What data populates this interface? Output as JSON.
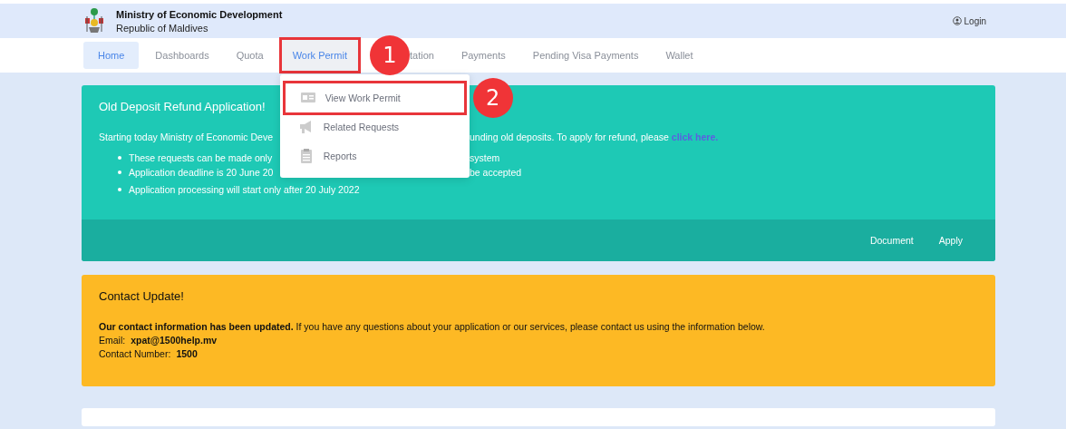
{
  "header": {
    "title": "Ministry of Economic Development",
    "subtitle": "Republic of Maldives",
    "login": "Login"
  },
  "nav": [
    {
      "label": "Home",
      "selected": true,
      "expanded": false,
      "highlighted": false
    },
    {
      "label": "Dashboards",
      "selected": false,
      "expanded": false,
      "highlighted": false
    },
    {
      "label": "Quota",
      "selected": false,
      "expanded": false,
      "highlighted": false
    },
    {
      "label": "Work Permit",
      "selected": false,
      "expanded": true,
      "highlighted": true,
      "callout": "1",
      "menu": [
        {
          "label": "View Work Permit",
          "kind": "card",
          "highlighted": true,
          "callout": "2"
        },
        {
          "label": "Related Requests",
          "kind": "megaphone",
          "highlighted": false
        },
        {
          "label": "Reports",
          "kind": "clipboard",
          "highlighted": false
        }
      ]
    },
    {
      "label": "tation",
      "selected": false,
      "expanded": false,
      "highlighted": false
    },
    {
      "label": "Payments",
      "selected": false,
      "expanded": false,
      "highlighted": false
    },
    {
      "label": "Pending Visa Payments",
      "selected": false,
      "expanded": false,
      "highlighted": false
    },
    {
      "label": "Wallet",
      "selected": false,
      "expanded": false,
      "highlighted": false
    }
  ],
  "refund_notice": {
    "title": "Old Deposit Refund Application!",
    "paragraph": {
      "parts": [
        "Starting today Ministry of Economic Deve",
        "unding old deposits. To apply for refund, please "
      ],
      "link": "click here."
    },
    "bullets": [
      {
        "parts": [
          "These requests can be made only",
          "system"
        ]
      },
      {
        "parts": [
          "Application deadline is 20 June 20",
          "be accepted"
        ]
      },
      {
        "parts": [
          "Application processing will start only after 20 July 2022"
        ]
      }
    ],
    "actions": [
      "Document",
      "Apply"
    ]
  },
  "contact_notice": {
    "title": "Contact Update!",
    "message": "**Our contact information has been updated.** If you have any questions about your application or our services, please contact us using the information below.",
    "lines": [
      {
        "label": "Email:",
        "value": "xpat@1500help.mv"
      },
      {
        "label": "Contact Number:",
        "value": "1500"
      }
    ]
  }
}
